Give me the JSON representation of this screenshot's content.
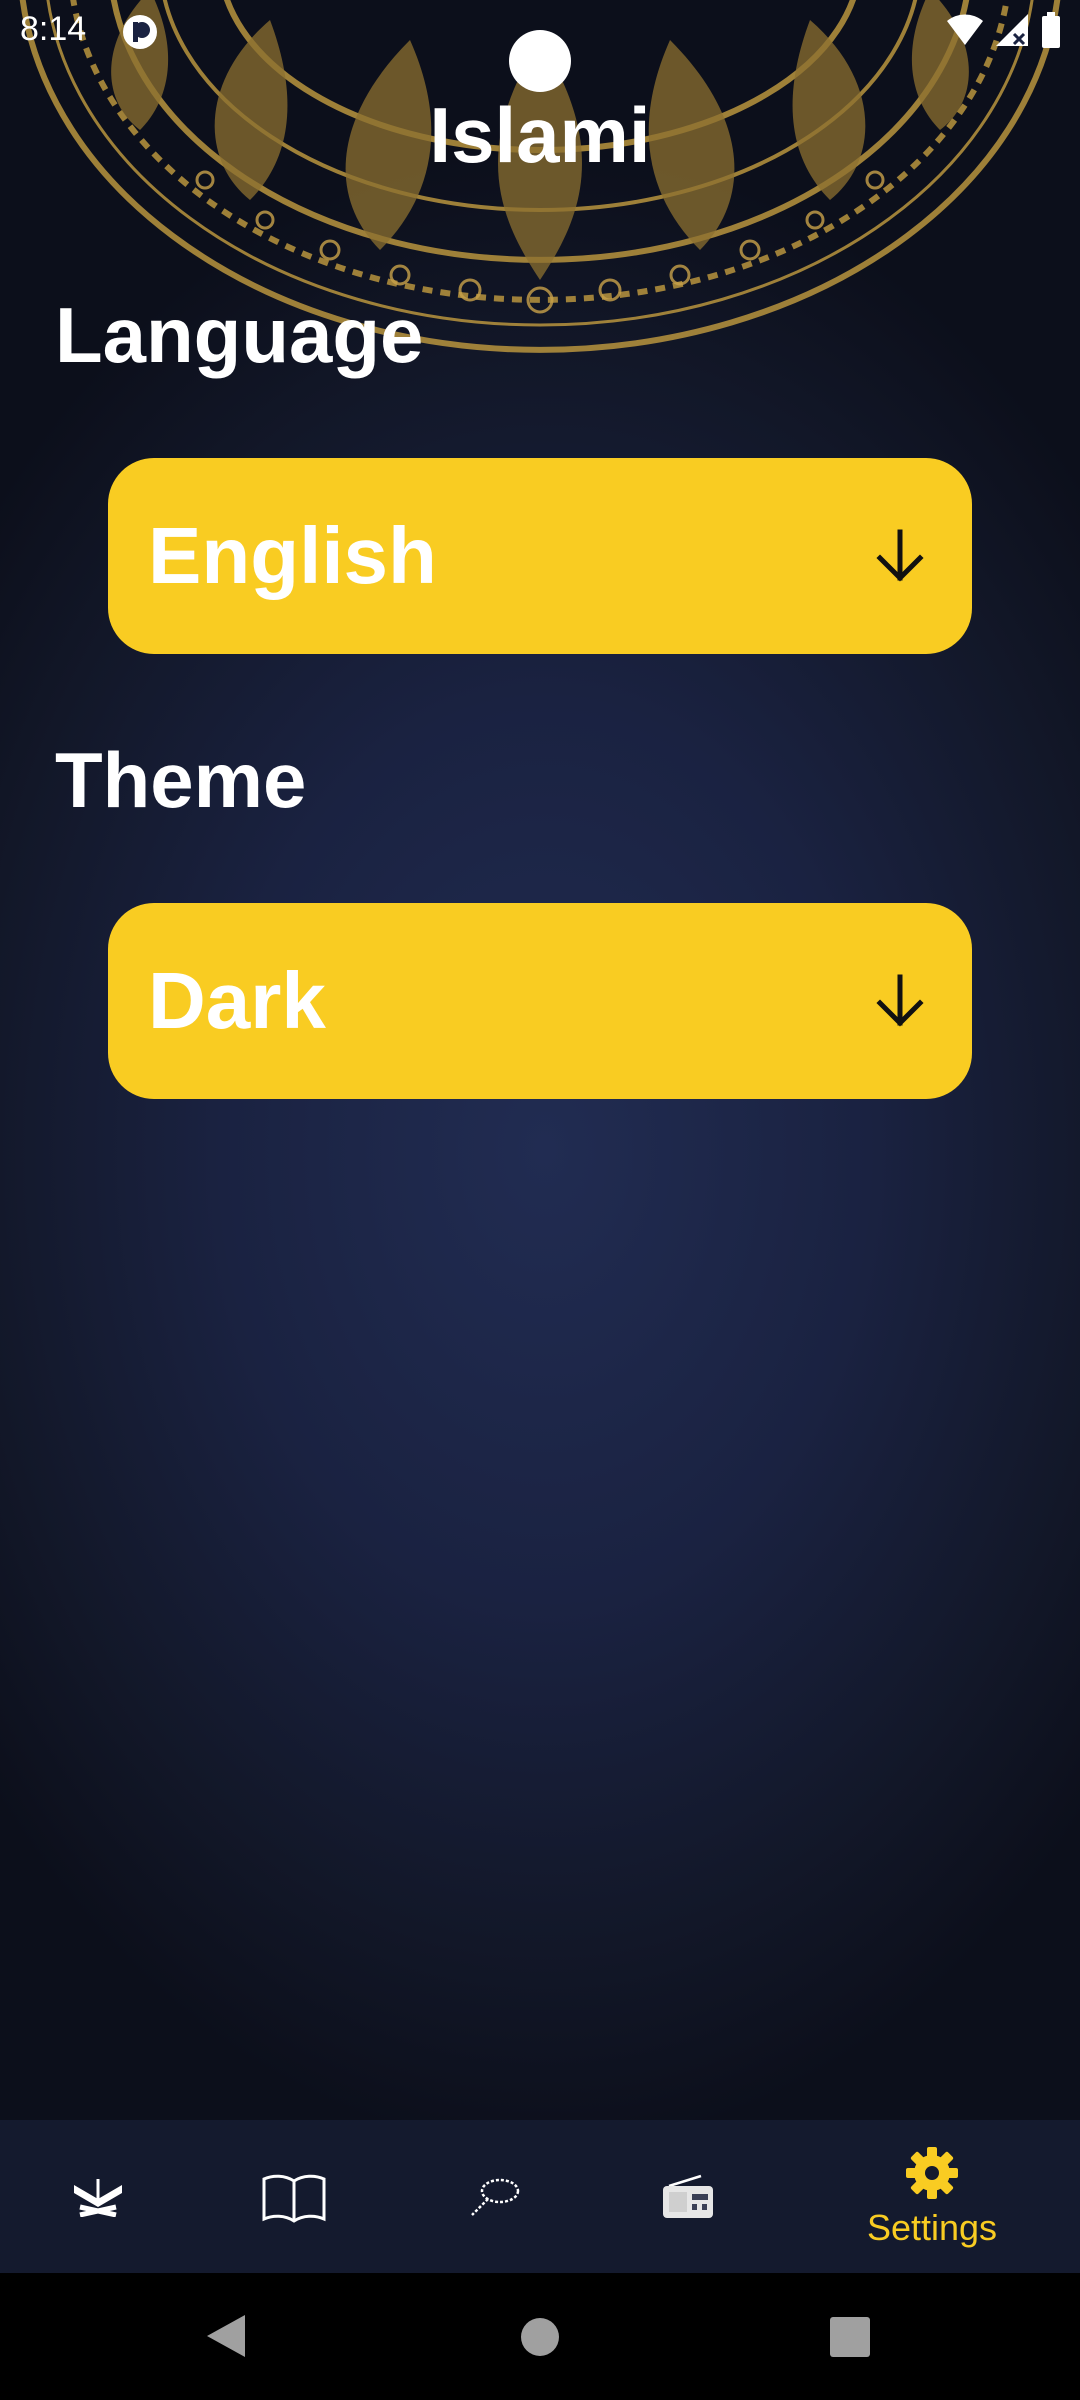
{
  "status_bar": {
    "time": "8:14"
  },
  "header": {
    "title": "Islami"
  },
  "settings": {
    "language_label": "Language",
    "language_value": "English",
    "theme_label": "Theme",
    "theme_value": "Dark"
  },
  "bottom_nav": {
    "items": [
      {
        "icon": "quran-icon",
        "label": ""
      },
      {
        "icon": "book-icon",
        "label": ""
      },
      {
        "icon": "tasbeeh-icon",
        "label": ""
      },
      {
        "icon": "radio-icon",
        "label": ""
      },
      {
        "icon": "gear-icon",
        "label": "Settings",
        "active": true
      }
    ]
  },
  "colors": {
    "accent": "#f9cc22",
    "background": "#1a2241",
    "nav_background": "#141a2e"
  }
}
